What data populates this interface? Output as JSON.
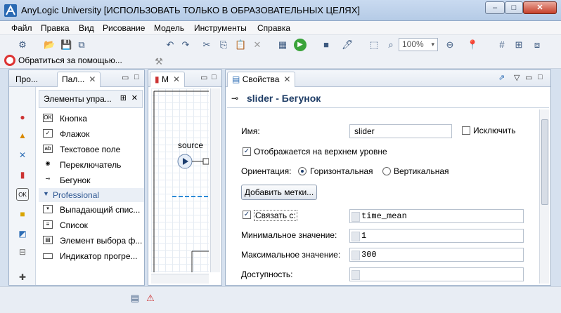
{
  "window": {
    "title": "AnyLogic University [ИСПОЛЬЗОВАТЬ ТОЛЬКО В ОБРАЗОВАТЕЛЬНЫХ ЦЕЛЯХ]",
    "min": "–",
    "max": "□",
    "close": "✕"
  },
  "menu": [
    "Файл",
    "Правка",
    "Вид",
    "Рисование",
    "Модель",
    "Инструменты",
    "Справка"
  ],
  "toolbar": {
    "zoom": "100%",
    "help_link": "Обратиться за помощью..."
  },
  "palette": {
    "tabs": [
      "Про...",
      "Пал..."
    ],
    "header": "Элементы упра...",
    "items": [
      {
        "label": "Кнопка",
        "icon": "button-icon"
      },
      {
        "label": "Флажок",
        "icon": "checkbox-icon"
      },
      {
        "label": "Текстовое поле",
        "icon": "textfield-icon"
      },
      {
        "label": "Переключатель",
        "icon": "radio-icon"
      },
      {
        "label": "Бегунок",
        "icon": "slider-icon"
      }
    ],
    "group": "Professional",
    "group_items": [
      {
        "label": "Выпадающий спис...",
        "icon": "dropdown-icon"
      },
      {
        "label": "Список",
        "icon": "list-icon"
      },
      {
        "label": "Элемент выбора ф...",
        "icon": "file-chooser-icon"
      },
      {
        "label": "Индикатор прогре...",
        "icon": "progress-icon"
      }
    ]
  },
  "model": {
    "tab": "M",
    "source_label": "source"
  },
  "properties": {
    "tab": "Свойства",
    "title": "slider - Бегунок",
    "name_label": "Имя:",
    "name_value": "slider",
    "exclude_label": "Исключить",
    "top_level_label": "Отображается на верхнем уровне",
    "orientation_label": "Ориентация:",
    "horizontal_label": "Горизонтальная",
    "vertical_label": "Вертикальная",
    "add_labels_button": "Добавить метки...",
    "link_label": "Связать с:",
    "link_value": "time_mean",
    "min_label": "Минимальное значение:",
    "min_value": "1",
    "max_label": "Максимальное значение:",
    "max_value": "300",
    "enabled_label": "Доступность:",
    "enabled_value": ""
  }
}
